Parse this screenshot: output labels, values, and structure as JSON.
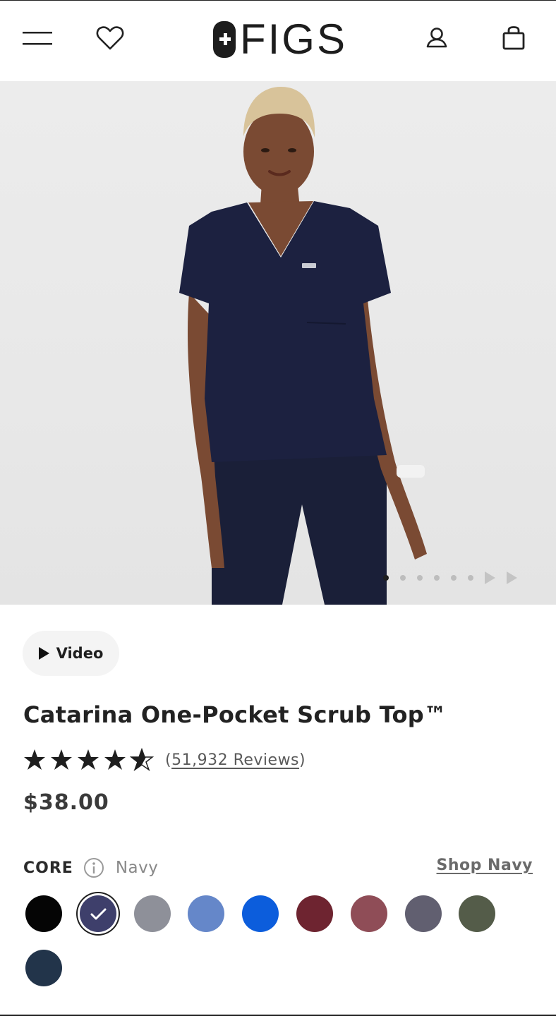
{
  "header": {
    "logo_text": "FIGS",
    "icons": [
      "menu-icon",
      "heart-icon",
      "account-icon",
      "bag-icon"
    ]
  },
  "gallery": {
    "image_count": 6,
    "active_index": 0
  },
  "video_button": {
    "label": "Video"
  },
  "product": {
    "title": "Catarina One-Pocket Scrub Top™",
    "rating": 4.5,
    "reviews_text": "51,932 Reviews",
    "price": "$38.00"
  },
  "colors": {
    "collection": "CORE",
    "selected_name": "Navy",
    "shop_link": "Shop Navy",
    "swatches": [
      {
        "name": "black",
        "hex": "#050505"
      },
      {
        "name": "navy",
        "hex": "#3e3f6b",
        "selected": true
      },
      {
        "name": "graphite",
        "hex": "#8e9099"
      },
      {
        "name": "ceil-blue",
        "hex": "#6587c9"
      },
      {
        "name": "royal-blue",
        "hex": "#0c5ddc"
      },
      {
        "name": "burgundy",
        "hex": "#6e2430"
      },
      {
        "name": "mauve",
        "hex": "#8f4d57"
      },
      {
        "name": "charcoal",
        "hex": "#615f70"
      },
      {
        "name": "olive",
        "hex": "#545c49"
      },
      {
        "name": "midnight",
        "hex": "#22344a"
      }
    ]
  }
}
